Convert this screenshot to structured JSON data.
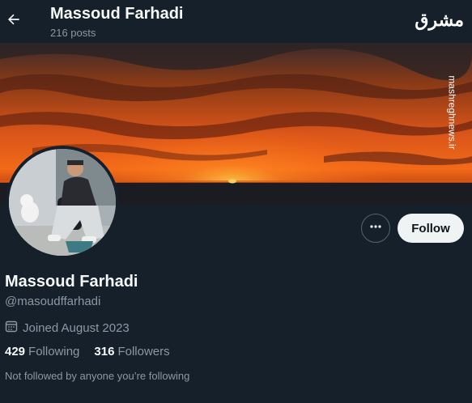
{
  "header": {
    "name": "Massoud Farhadi",
    "posts": "216 posts"
  },
  "watermark": {
    "logo_text": "مشرق",
    "site": "mashreghnews.ir"
  },
  "profile": {
    "name": "Massoud Farhadi",
    "handle": "@masoudffarhadi",
    "joined": "Joined August 2023",
    "following_count": "429",
    "following_label": "Following",
    "followers_count": "316",
    "followers_label": "Followers",
    "not_followed_note": "Not followed by anyone you’re following"
  },
  "actions": {
    "follow_label": "Follow"
  },
  "icons": {
    "back": "arrow-left-icon",
    "more": "more-dots-icon",
    "calendar": "calendar-icon"
  },
  "colors": {
    "background": "#15202b",
    "secondary_text": "#8b98a5",
    "follow_button_bg": "#eff3f4"
  }
}
